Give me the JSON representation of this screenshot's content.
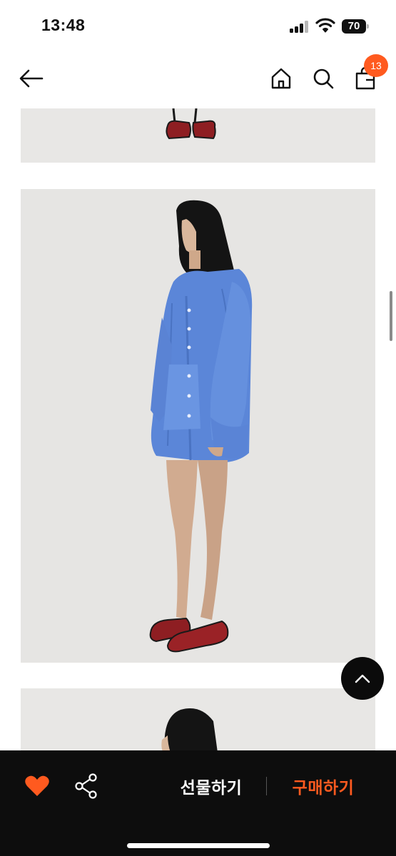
{
  "status_bar": {
    "time": "13:48",
    "battery": "70",
    "icons": [
      "signal-icon",
      "wifi-icon",
      "battery-icon"
    ]
  },
  "header": {
    "icons": [
      "back-arrow-icon",
      "home-icon",
      "search-icon",
      "shopping-bag-icon"
    ],
    "cart_count": "13",
    "badge_color": "#ff5a1f"
  },
  "content": {
    "images": [
      "product-photo-top",
      "product-photo-main",
      "product-photo-bottom"
    ]
  },
  "scroll_top_icon": "chevron-up-icon",
  "bottom_bar": {
    "wishlist_icon": "heart-icon",
    "wishlist_color": "#ff5a1f",
    "share_icon": "share-icon",
    "gift_label": "선물하기",
    "buy_label": "구매하기",
    "buy_color": "#ff5a1f"
  }
}
